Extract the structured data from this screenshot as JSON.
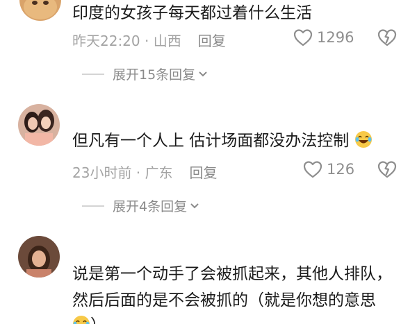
{
  "comments": [
    {
      "text": "印度的女孩子每天都过着什么生活",
      "time": "昨天22:20",
      "location": "山西",
      "reply_label": "回复",
      "likes": "1296",
      "expand_label": "展开15条回复"
    },
    {
      "text": "但凡有一个人上 估计场面都没办法控制",
      "time": "23小时前",
      "location": "广东",
      "reply_label": "回复",
      "likes": "126",
      "expand_label": "展开4条回复"
    },
    {
      "text_line1": "说是第一个动手了会被抓起来，其他人排队，",
      "text_line2": "然后后面的是不会被抓的（就是你想的意思",
      "text_line3": "）"
    }
  ],
  "separator": " · ",
  "colors": {
    "text": "#1b1b1b",
    "meta": "#a3a3a3",
    "icon": "#8e8e8e"
  },
  "icons": [
    "heart-icon",
    "dislike-icon",
    "chevron-down-icon",
    "laughing-emoji-icon",
    "avatar"
  ]
}
